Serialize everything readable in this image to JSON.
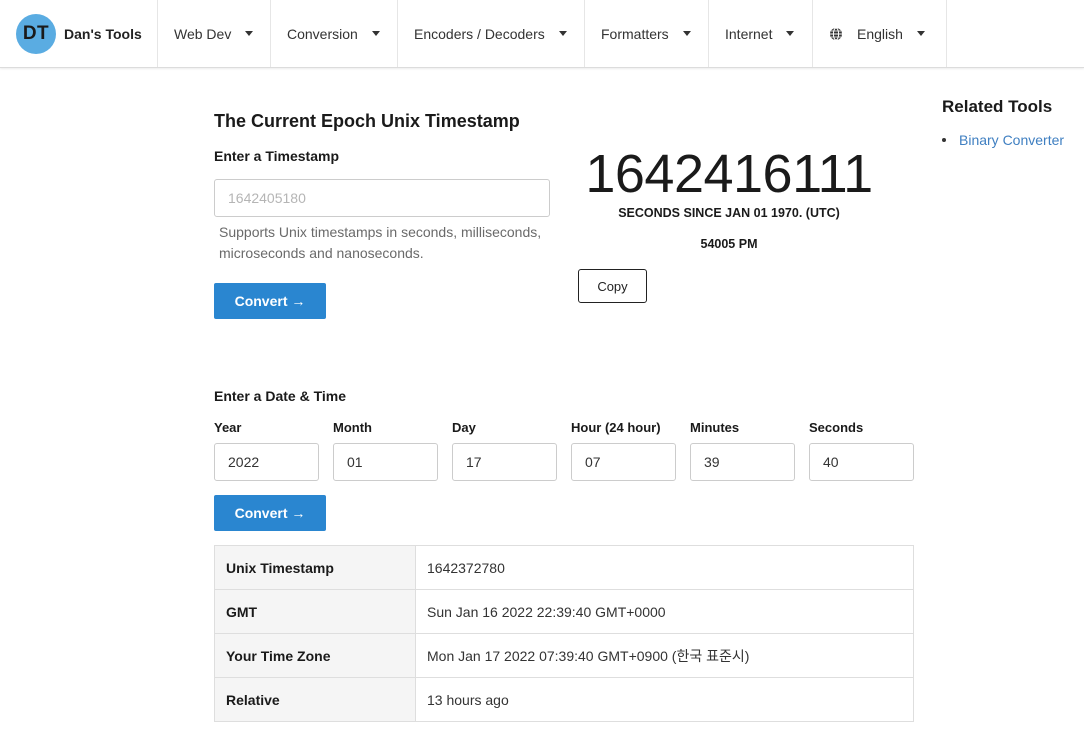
{
  "nav": {
    "logo_text": "DT",
    "brand": "Dan's Tools",
    "items": [
      {
        "label": "Web Dev"
      },
      {
        "label": "Conversion"
      },
      {
        "label": "Encoders / Decoders"
      },
      {
        "label": "Formatters"
      },
      {
        "label": "Internet"
      }
    ],
    "language": "English",
    "icons": {
      "dropdown": "chevron-down-icon",
      "language": "globe-icon"
    }
  },
  "main": {
    "title": "The Current Epoch Unix Timestamp",
    "timestamp_section": {
      "label": "Enter a Timestamp",
      "placeholder": "1642405180",
      "value": "",
      "helper": "Supports Unix timestamps in seconds, milliseconds, microseconds and nanoseconds.",
      "convert_label": "Convert →"
    },
    "current": {
      "timestamp": "1642416111",
      "caption": "SECONDS SINCE JAN 01 1970. (UTC)",
      "time": "54005 PM",
      "copy_label": "Copy"
    },
    "datetime_section": {
      "label": "Enter a Date & Time",
      "fields": [
        {
          "label": "Year",
          "value": "2022"
        },
        {
          "label": "Month",
          "value": "01"
        },
        {
          "label": "Day",
          "value": "17"
        },
        {
          "label": "Hour (24 hour)",
          "value": "07"
        },
        {
          "label": "Minutes",
          "value": "39"
        },
        {
          "label": "Seconds",
          "value": "40"
        }
      ],
      "convert_label": "Convert →"
    },
    "results": [
      {
        "key": "Unix Timestamp",
        "value": "1642372780"
      },
      {
        "key": "GMT",
        "value": "Sun Jan 16 2022 22:39:40 GMT+0000"
      },
      {
        "key": "Your Time Zone",
        "value": "Mon Jan 17 2022 07:39:40 GMT+0900 (한국 표준시)"
      },
      {
        "key": "Relative",
        "value": "13 hours ago"
      }
    ]
  },
  "sidebar": {
    "title": "Related Tools",
    "links": [
      {
        "label": "Binary Converter"
      }
    ]
  },
  "colors": {
    "accent": "#2a86d0",
    "logo": "#5aace2",
    "link": "#3f7fc1"
  }
}
